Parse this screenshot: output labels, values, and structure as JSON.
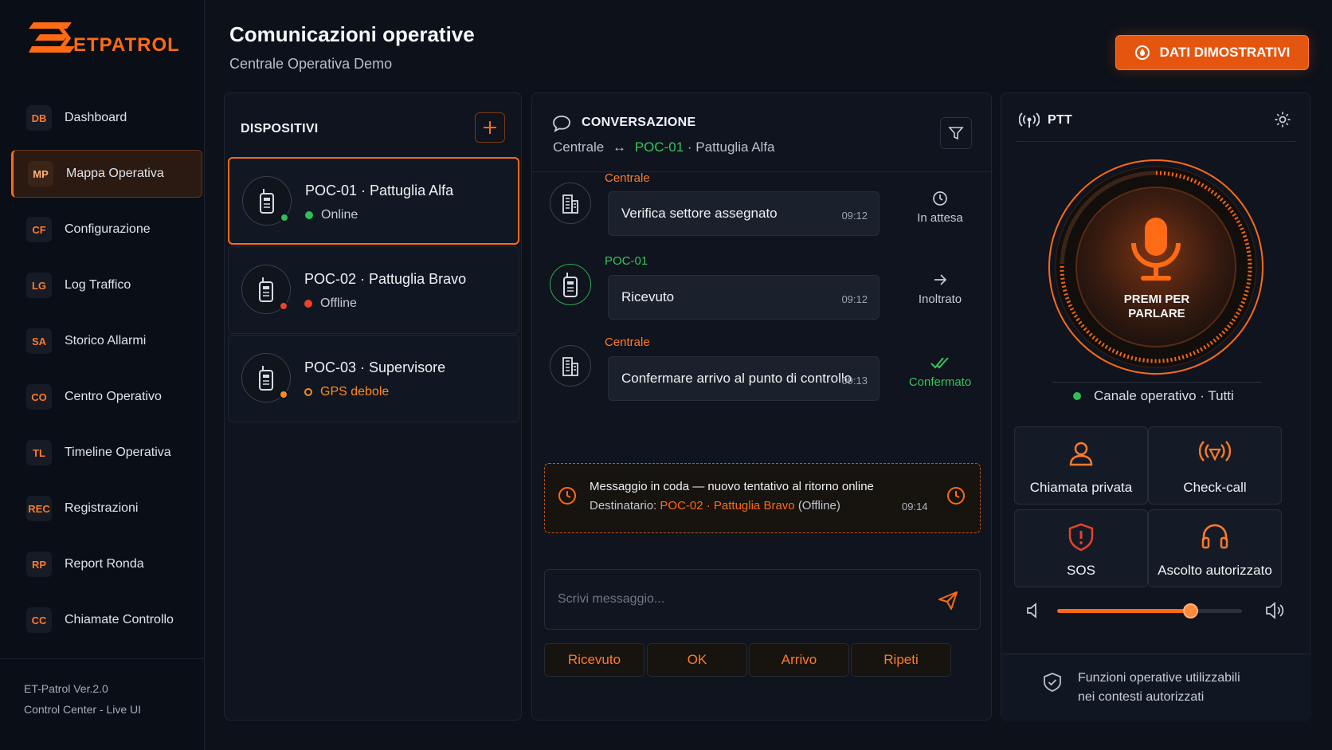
{
  "app": {
    "brand": "ETPATROL",
    "version": "ET-Patrol Ver.2.0",
    "subtitle": "Control Center - Live UI",
    "accent": "#ff6a14"
  },
  "header": {
    "title": "Comunicazioni operative",
    "subtitle": "Centrale Operativa Demo",
    "demo_button": "DATI DIMOSTRATIVI"
  },
  "sidebar": {
    "items": [
      {
        "abbr": "DB",
        "label": "Dashboard"
      },
      {
        "abbr": "MP",
        "label": "Mappa Operativa",
        "active": true
      },
      {
        "abbr": "CF",
        "label": "Configurazione"
      },
      {
        "abbr": "LG",
        "label": "Log Traffico"
      },
      {
        "abbr": "SA",
        "label": "Storico Allarmi"
      },
      {
        "abbr": "CO",
        "label": "Centro Operativo"
      },
      {
        "abbr": "TL",
        "label": "Timeline Operativa"
      },
      {
        "abbr": "REC",
        "label": "Registrazioni"
      },
      {
        "abbr": "RP",
        "label": "Report Ronda"
      },
      {
        "abbr": "CC",
        "label": "Chiamate Controllo"
      }
    ]
  },
  "devices": {
    "title": "DISPOSITIVI",
    "items": [
      {
        "id": "POC-01",
        "name": "Pattuglia Alfa",
        "status": "Online",
        "color": "#2fbf56"
      },
      {
        "id": "POC-02",
        "name": "Pattuglia Bravo",
        "status": "Offline",
        "color": "#e8432c"
      },
      {
        "id": "POC-03",
        "name": "Supervisore",
        "status": "GPS debole",
        "color": "#ff8a1e"
      }
    ]
  },
  "conversation": {
    "title": "CONVERSAZIONE",
    "from": "Centrale",
    "arrow": "↔",
    "to_id": "POC-01",
    "to_name": "· Pattuglia Alfa",
    "messages": [
      {
        "sender": "Centrale",
        "text": "Verifica settore assegnato",
        "time": "09:12",
        "status": "In attesa"
      },
      {
        "sender": "POC-01",
        "text": "Ricevuto",
        "time": "09:12",
        "status": "Inoltrato"
      },
      {
        "sender": "Centrale",
        "text": "Confermare arrivo al punto di controllo",
        "time": "09:13",
        "status": "Confermato"
      }
    ],
    "queue": {
      "line1": "Messaggio in coda — nuovo tentativo al ritorno online",
      "recipient_label": "Destinatario:",
      "recipient": "POC-02 · Pattuglia Bravo",
      "recipient_state": "(Offline)",
      "time": "09:14"
    },
    "input_placeholder": "Scrivi messaggio...",
    "quick_replies": [
      "Ricevuto",
      "OK",
      "Arrivo",
      "Ripeti"
    ]
  },
  "ptt": {
    "title": "PTT",
    "button_label": "PREMI PER PARLARE",
    "channel": "Canale operativo · Tutti",
    "actions": [
      "Chiamata privata",
      "Check-call",
      "SOS",
      "Ascolto autorizzato"
    ],
    "volume": 0.72,
    "footer": [
      "Funzioni operative utilizzabili",
      "nei contesti autorizzati"
    ]
  }
}
